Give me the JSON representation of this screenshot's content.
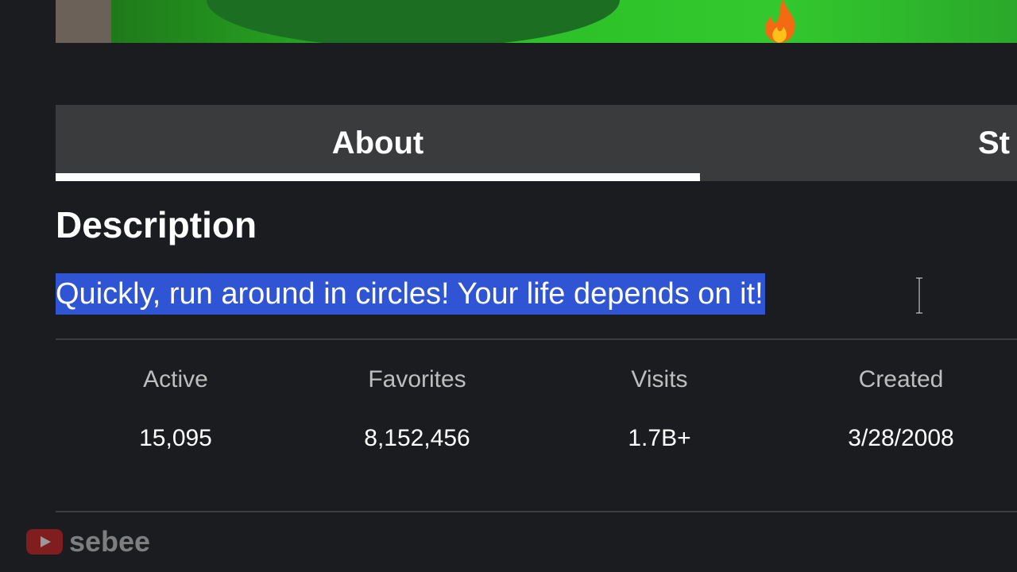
{
  "tabs": [
    {
      "label": "About",
      "selected": true
    },
    {
      "label": "St",
      "selected": false
    }
  ],
  "description": {
    "heading": "Description",
    "text": "Quickly, run around in circles! Your life depends on it!",
    "selected": true
  },
  "stats": [
    {
      "label": "Active",
      "value": "15,095"
    },
    {
      "label": "Favorites",
      "value": "8,152,456"
    },
    {
      "label": "Visits",
      "value": "1.7B+"
    },
    {
      "label": "Created",
      "value": "3/28/2008"
    }
  ],
  "watermark": {
    "icon": "youtube-icon",
    "text": "sebee"
  },
  "colors": {
    "background": "#1b1c1f",
    "tab_bar": "#393b3d",
    "selection": "#2f55d4",
    "stat_label": "#bdbebe"
  }
}
